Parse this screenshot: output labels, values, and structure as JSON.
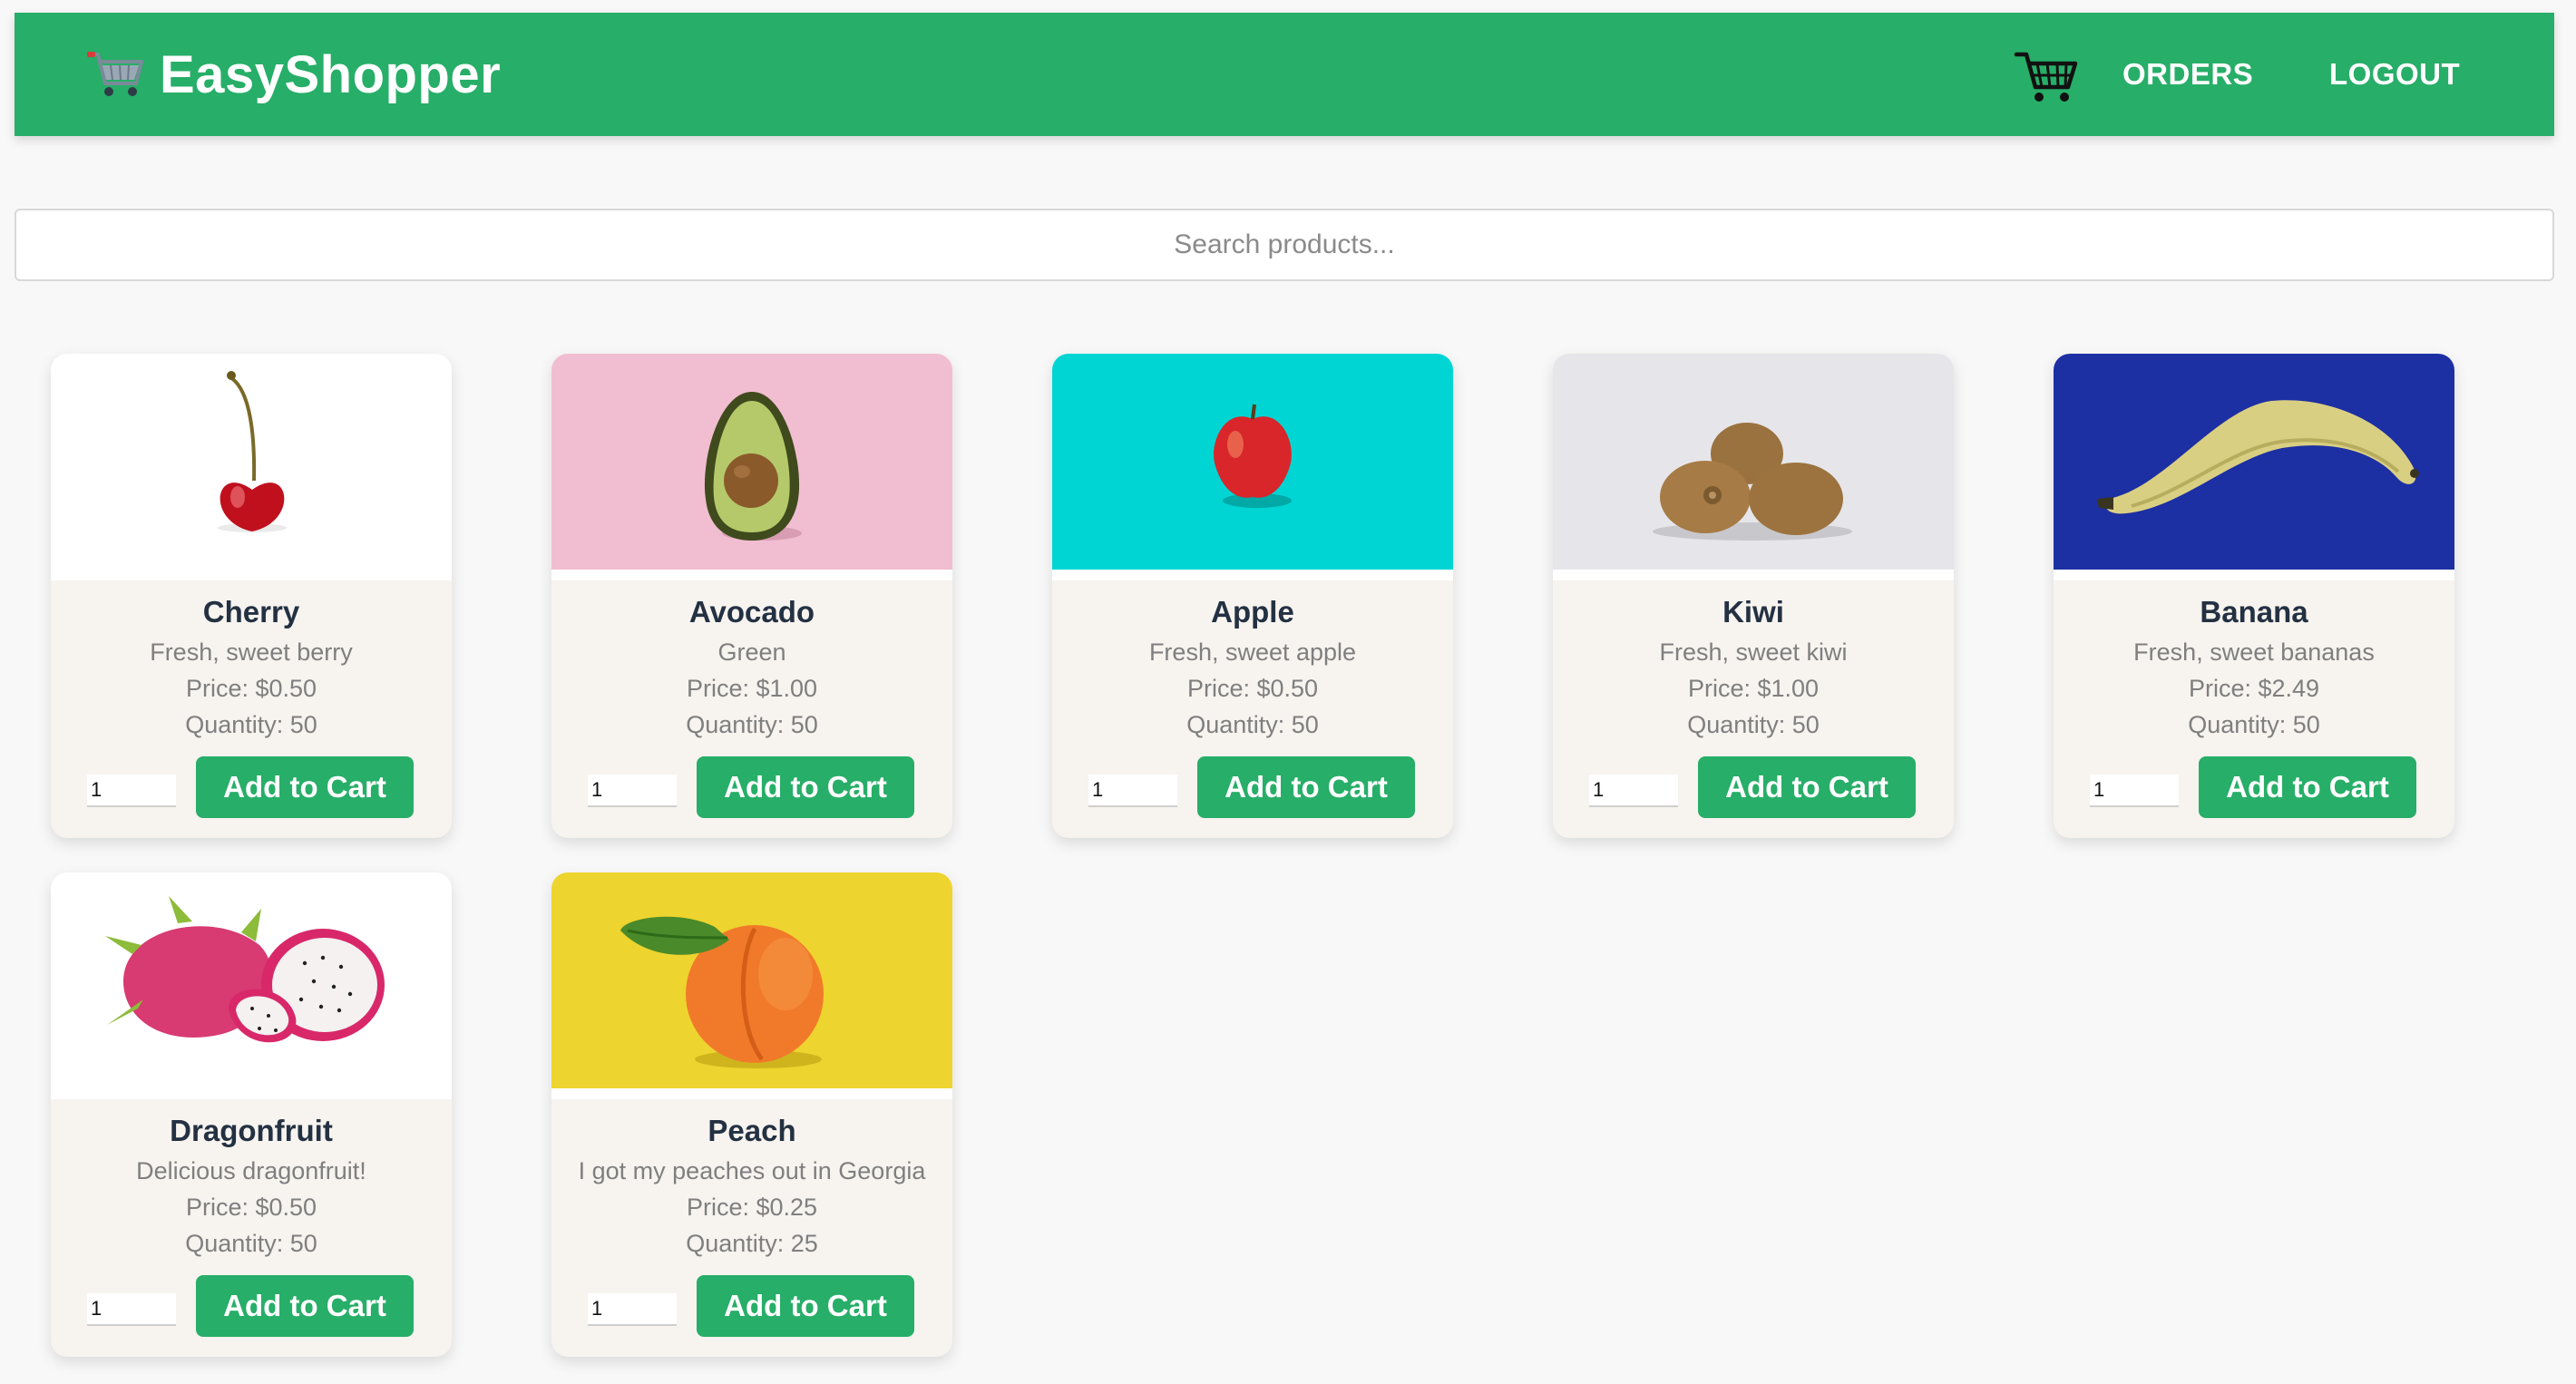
{
  "header": {
    "brand": "EasyShopper",
    "logo_icon": "shopping-cart-emoji-icon",
    "cart_icon": "cart-icon",
    "orders_label": "ORDERS",
    "logout_label": "LOGOUT"
  },
  "search": {
    "placeholder": "Search products...",
    "value": ""
  },
  "products": [
    {
      "name": "Cherry",
      "description": "Fresh, sweet berry",
      "price": "Price: $0.50",
      "quantity": "Quantity: 50",
      "qty_value": "1",
      "button": "Add to Cart"
    },
    {
      "name": "Avocado",
      "description": "Green",
      "price": "Price: $1.00",
      "quantity": "Quantity: 50",
      "qty_value": "1",
      "button": "Add to Cart"
    },
    {
      "name": "Apple",
      "description": "Fresh, sweet apple",
      "price": "Price: $0.50",
      "quantity": "Quantity: 50",
      "qty_value": "1",
      "button": "Add to Cart"
    },
    {
      "name": "Kiwi",
      "description": "Fresh, sweet kiwi",
      "price": "Price: $1.00",
      "quantity": "Quantity: 50",
      "qty_value": "1",
      "button": "Add to Cart"
    },
    {
      "name": "Banana",
      "description": "Fresh, sweet bananas",
      "price": "Price: $2.49",
      "quantity": "Quantity: 50",
      "qty_value": "1",
      "button": "Add to Cart"
    },
    {
      "name": "Dragonfruit",
      "description": "Delicious dragonfruit!",
      "price": "Price: $0.50",
      "quantity": "Quantity: 50",
      "qty_value": "1",
      "button": "Add to Cart"
    },
    {
      "name": "Peach",
      "description": "I got my peaches out in Georgia",
      "price": "Price: $0.25",
      "quantity": "Quantity: 25",
      "qty_value": "1",
      "button": "Add to Cart"
    }
  ],
  "colors": {
    "brand_green": "#27ae68",
    "page_bg": "#f8f8f8",
    "card_bg": "#f7f3ef",
    "title_text": "#233142",
    "muted_text": "#7f7f7f"
  }
}
